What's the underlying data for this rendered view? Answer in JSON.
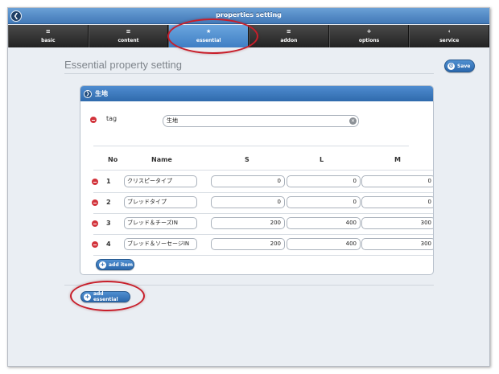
{
  "window": {
    "title": "properties setting"
  },
  "nav": [
    {
      "label": "basic",
      "glyph": "≡"
    },
    {
      "label": "content",
      "glyph": "≡"
    },
    {
      "label": "essential",
      "glyph": "★"
    },
    {
      "label": "addon",
      "glyph": "≡"
    },
    {
      "label": "options",
      "glyph": "+"
    },
    {
      "label": "service",
      "glyph": "‹"
    }
  ],
  "page": {
    "title": "Essential property setting",
    "save_label": "Save"
  },
  "panel": {
    "title": "生地",
    "tag_label": "tag",
    "tag_value": "生地",
    "columns": [
      "No",
      "Name",
      "S",
      "L",
      "M"
    ],
    "rows": [
      {
        "no": "1",
        "name": "クリスピータイプ",
        "s": "0",
        "l": "0",
        "m": "0"
      },
      {
        "no": "2",
        "name": "ブレッドタイプ",
        "s": "0",
        "l": "0",
        "m": "0"
      },
      {
        "no": "3",
        "name": "ブレッド＆チーズIN",
        "s": "200",
        "l": "400",
        "m": "300"
      },
      {
        "no": "4",
        "name": "ブレッド＆ソーセージIN",
        "s": "200",
        "l": "400",
        "m": "300"
      }
    ],
    "add_item_label": "add item"
  },
  "add_essential_label": "add essential",
  "colors": {
    "accent": "#3f7ec4",
    "highlight": "#c81e2a",
    "delete": "#d2333b"
  }
}
